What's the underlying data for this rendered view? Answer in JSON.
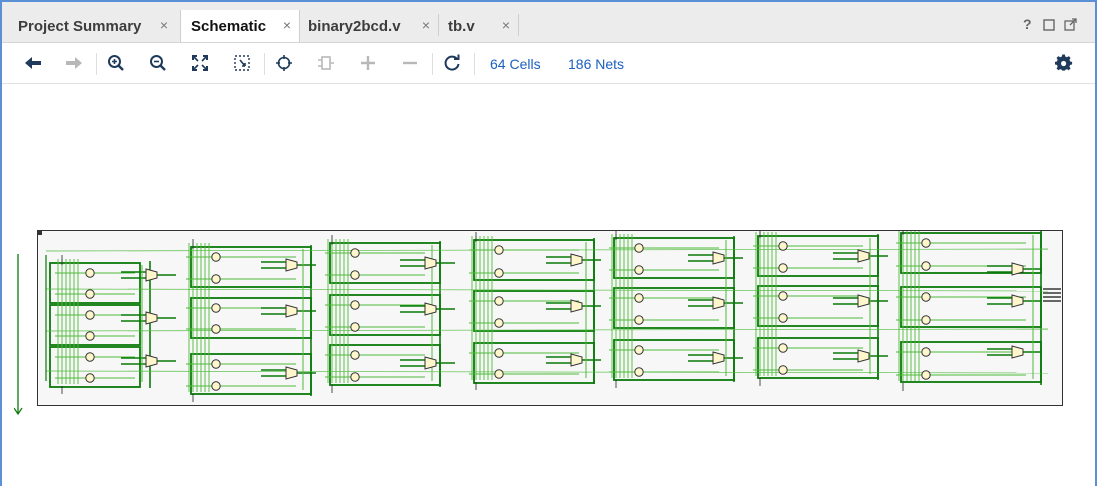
{
  "tabs": [
    {
      "label": "Project Summary",
      "active": false
    },
    {
      "label": "Schematic",
      "active": true
    },
    {
      "label": "binary2bcd.v",
      "active": false
    },
    {
      "label": "tb.v",
      "active": false
    }
  ],
  "tab_close_glyph": "×",
  "window_controls": {
    "help": "?",
    "restore_icon": "restore-icon",
    "float_icon": "float-icon"
  },
  "toolbar": {
    "icons": [
      "back-arrow-icon",
      "forward-arrow-icon",
      "zoom-in-icon",
      "zoom-out-icon",
      "zoom-fit-icon",
      "zoom-area-icon",
      "select-icon",
      "cell-icon",
      "expand-icon",
      "collapse-icon",
      "refresh-icon",
      "settings-gear-icon"
    ],
    "cells_label": "64 Cells",
    "nets_label": "186 Nets"
  },
  "colors": {
    "accent": "#1b5fbf",
    "wire_dark": "#0a7a0a",
    "wire_light": "#4dbb3a",
    "mux_fill": "#fff6cc",
    "frame": "#5b8fd6"
  }
}
